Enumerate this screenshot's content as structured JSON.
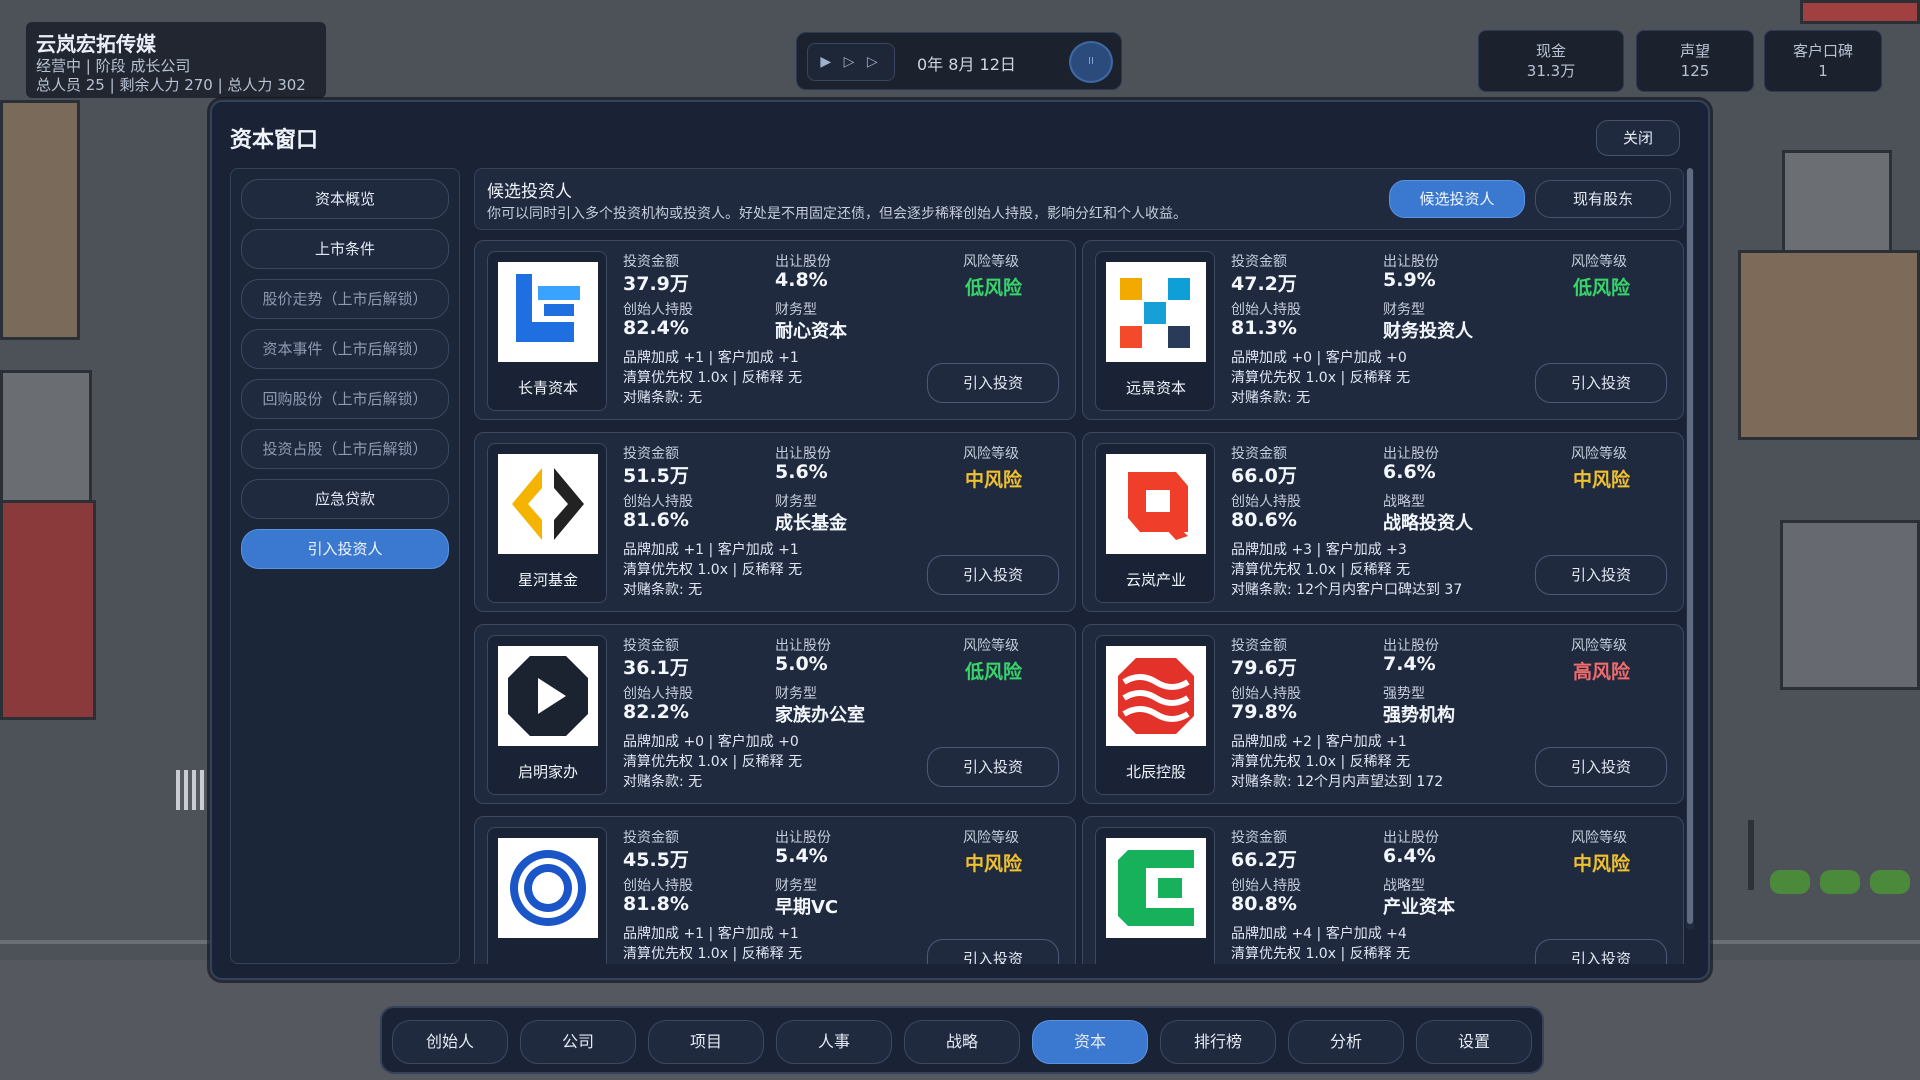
{
  "hud": {
    "company_name": "云岚宏拓传媒",
    "status_line": "经营中 | 阶段 成长公司",
    "staff_line": "总人员 25 | 剩余人力 270 | 总人力 302",
    "speed_label": "▶ ▷ ▷",
    "date": "0年 8月 12日",
    "pause_label": "II",
    "stats": [
      {
        "label": "现金",
        "value": "31.3万"
      },
      {
        "label": "声望",
        "value": "125"
      },
      {
        "label": "客户口碑",
        "value": "1"
      }
    ]
  },
  "window": {
    "title": "资本窗口",
    "close_label": "关闭"
  },
  "sidebar": {
    "items": [
      {
        "label": "资本概览",
        "state": "normal"
      },
      {
        "label": "上市条件",
        "state": "normal"
      },
      {
        "label": "股价走势（上市后解锁）",
        "state": "locked"
      },
      {
        "label": "资本事件（上市后解锁）",
        "state": "locked"
      },
      {
        "label": "回购股份（上市后解锁）",
        "state": "locked"
      },
      {
        "label": "投资占股（上市后解锁）",
        "state": "locked"
      },
      {
        "label": "应急贷款",
        "state": "normal"
      },
      {
        "label": "引入投资人",
        "state": "active"
      }
    ]
  },
  "panel": {
    "title": "候选投资人",
    "description": "你可以同时引入多个投资机构或投资人。好处是不用固定还债，但会逐步稀释创始人持股，影响分红和个人收益。",
    "tabs": [
      {
        "label": "候选投资人",
        "active": true
      },
      {
        "label": "现有股东",
        "active": false
      }
    ]
  },
  "labels": {
    "amount": "投资金额",
    "share": "出让股份",
    "risk": "风险等级",
    "founder": "创始人持股",
    "invest_button": "引入投资"
  },
  "colors": {
    "low_risk": "#37d46a",
    "mid_risk": "#f0c030",
    "high_risk": "#f06b6b",
    "accent": "#3b78cf"
  },
  "investors": [
    {
      "name": "长青资本",
      "logo": "blue-block-logo",
      "amount": "37.9万",
      "share": "4.8%",
      "risk": "低风险",
      "risk_level": "low",
      "founder": "82.4%",
      "type_label": "财务型",
      "type": "耐心资本",
      "bonus": "品牌加成 +1 | 客户加成 +1",
      "terms": "清算优先权 1.0x | 反稀释 无",
      "vam": "对赌条款: 无"
    },
    {
      "name": "远景资本",
      "logo": "pixel-squares-logo",
      "amount": "47.2万",
      "share": "5.9%",
      "risk": "低风险",
      "risk_level": "low",
      "founder": "81.3%",
      "type_label": "财务型",
      "type": "财务投资人",
      "bonus": "品牌加成 +0 | 客户加成 +0",
      "terms": "清算优先权 1.0x | 反稀释 无",
      "vam": "对赌条款: 无"
    },
    {
      "name": "星河基金",
      "logo": "yellow-chevron-logo",
      "amount": "51.5万",
      "share": "5.6%",
      "risk": "中风险",
      "risk_level": "mid",
      "founder": "81.6%",
      "type_label": "财务型",
      "type": "成长基金",
      "bonus": "品牌加成 +1 | 客户加成 +1",
      "terms": "清算优先权 1.0x | 反稀释 无",
      "vam": "对赌条款: 无"
    },
    {
      "name": "云岚产业",
      "logo": "red-square-logo",
      "amount": "66.0万",
      "share": "6.6%",
      "risk": "中风险",
      "risk_level": "mid",
      "founder": "80.6%",
      "type_label": "战略型",
      "type": "战略投资人",
      "bonus": "品牌加成 +3 | 客户加成 +3",
      "terms": "清算优先权 1.0x | 反稀释 无",
      "vam": "对赌条款: 12个月内客户口碑达到 37"
    },
    {
      "name": "启明家办",
      "logo": "play-octagon-logo",
      "amount": "36.1万",
      "share": "5.0%",
      "risk": "低风险",
      "risk_level": "low",
      "founder": "82.2%",
      "type_label": "财务型",
      "type": "家族办公室",
      "bonus": "品牌加成 +0 | 客户加成 +0",
      "terms": "清算优先权 1.0x | 反稀释 无",
      "vam": "对赌条款: 无"
    },
    {
      "name": "北辰控股",
      "logo": "red-waves-logo",
      "amount": "79.6万",
      "share": "7.4%",
      "risk": "高风险",
      "risk_level": "high",
      "founder": "79.8%",
      "type_label": "强势型",
      "type": "强势机构",
      "bonus": "品牌加成 +2 | 客户加成 +1",
      "terms": "清算优先权 1.0x | 反稀释 无",
      "vam": "对赌条款: 12个月内声望达到 172"
    },
    {
      "name": "",
      "logo": "blue-rings-logo",
      "amount": "45.5万",
      "share": "5.4%",
      "risk": "中风险",
      "risk_level": "mid",
      "founder": "81.8%",
      "type_label": "财务型",
      "type": "早期VC",
      "bonus": "品牌加成 +1 | 客户加成 +1",
      "terms": "清算优先权 1.0x | 反稀释 无",
      "vam": ""
    },
    {
      "name": "",
      "logo": "green-c-logo",
      "amount": "66.2万",
      "share": "6.4%",
      "risk": "中风险",
      "risk_level": "mid",
      "founder": "80.8%",
      "type_label": "战略型",
      "type": "产业资本",
      "bonus": "品牌加成 +4 | 客户加成 +4",
      "terms": "清算优先权 1.0x | 反稀释 无",
      "vam": ""
    }
  ],
  "bottom_nav": [
    {
      "label": "创始人",
      "active": false
    },
    {
      "label": "公司",
      "active": false
    },
    {
      "label": "项目",
      "active": false
    },
    {
      "label": "人事",
      "active": false
    },
    {
      "label": "战略",
      "active": false
    },
    {
      "label": "资本",
      "active": true
    },
    {
      "label": "排行榜",
      "active": false
    },
    {
      "label": "分析",
      "active": false
    },
    {
      "label": "设置",
      "active": false
    }
  ]
}
